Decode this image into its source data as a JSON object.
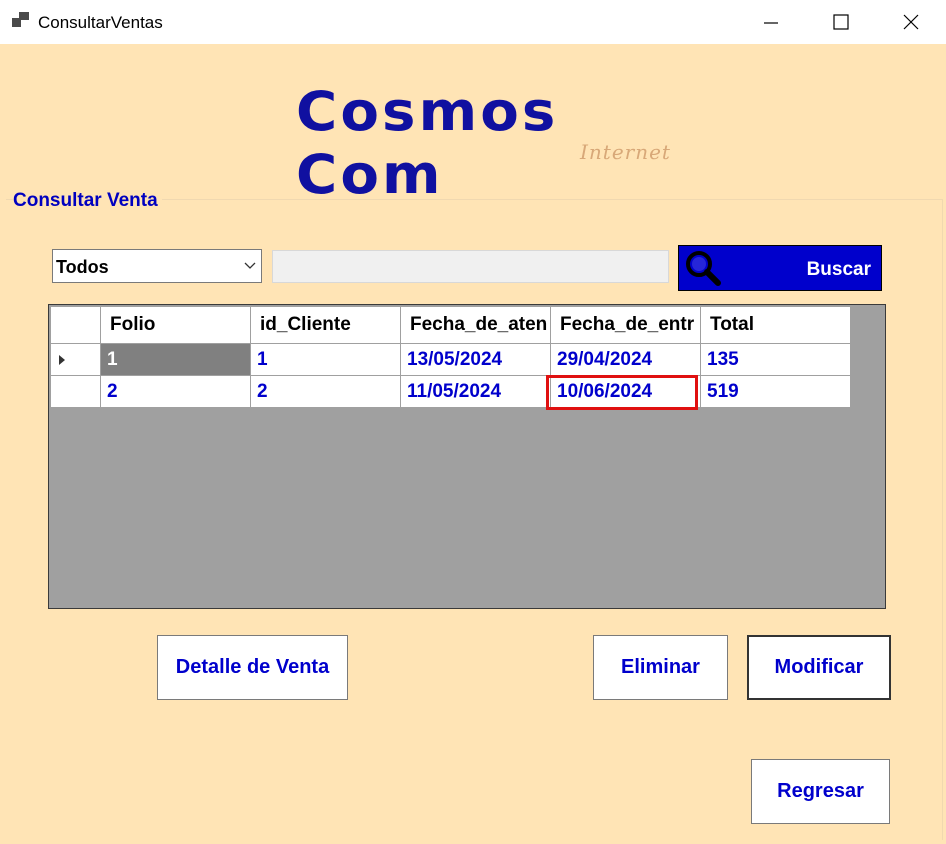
{
  "window": {
    "title": "ConsultarVentas"
  },
  "logo": {
    "main": "Cosmos Com",
    "sub": "Internet"
  },
  "group": {
    "title": "Consultar Venta"
  },
  "filter": {
    "selected": "Todos",
    "search_value": "",
    "search_button": "Buscar"
  },
  "grid": {
    "columns": [
      "Folio",
      "id_Cliente",
      "Fecha_de_aten",
      "Fecha_de_entr",
      "Total"
    ],
    "rows": [
      [
        "1",
        "1",
        "13/05/2024",
        "29/04/2024",
        "135"
      ],
      [
        "2",
        "2",
        "11/05/2024",
        "10/06/2024",
        "519"
      ]
    ]
  },
  "buttons": {
    "detalle": "Detalle de Venta",
    "eliminar": "Eliminar",
    "modificar": "Modificar",
    "regresar": "Regresar"
  },
  "colors": {
    "background": "#ffe4b5",
    "accent": "#0000cc",
    "highlight": "#e01010"
  }
}
